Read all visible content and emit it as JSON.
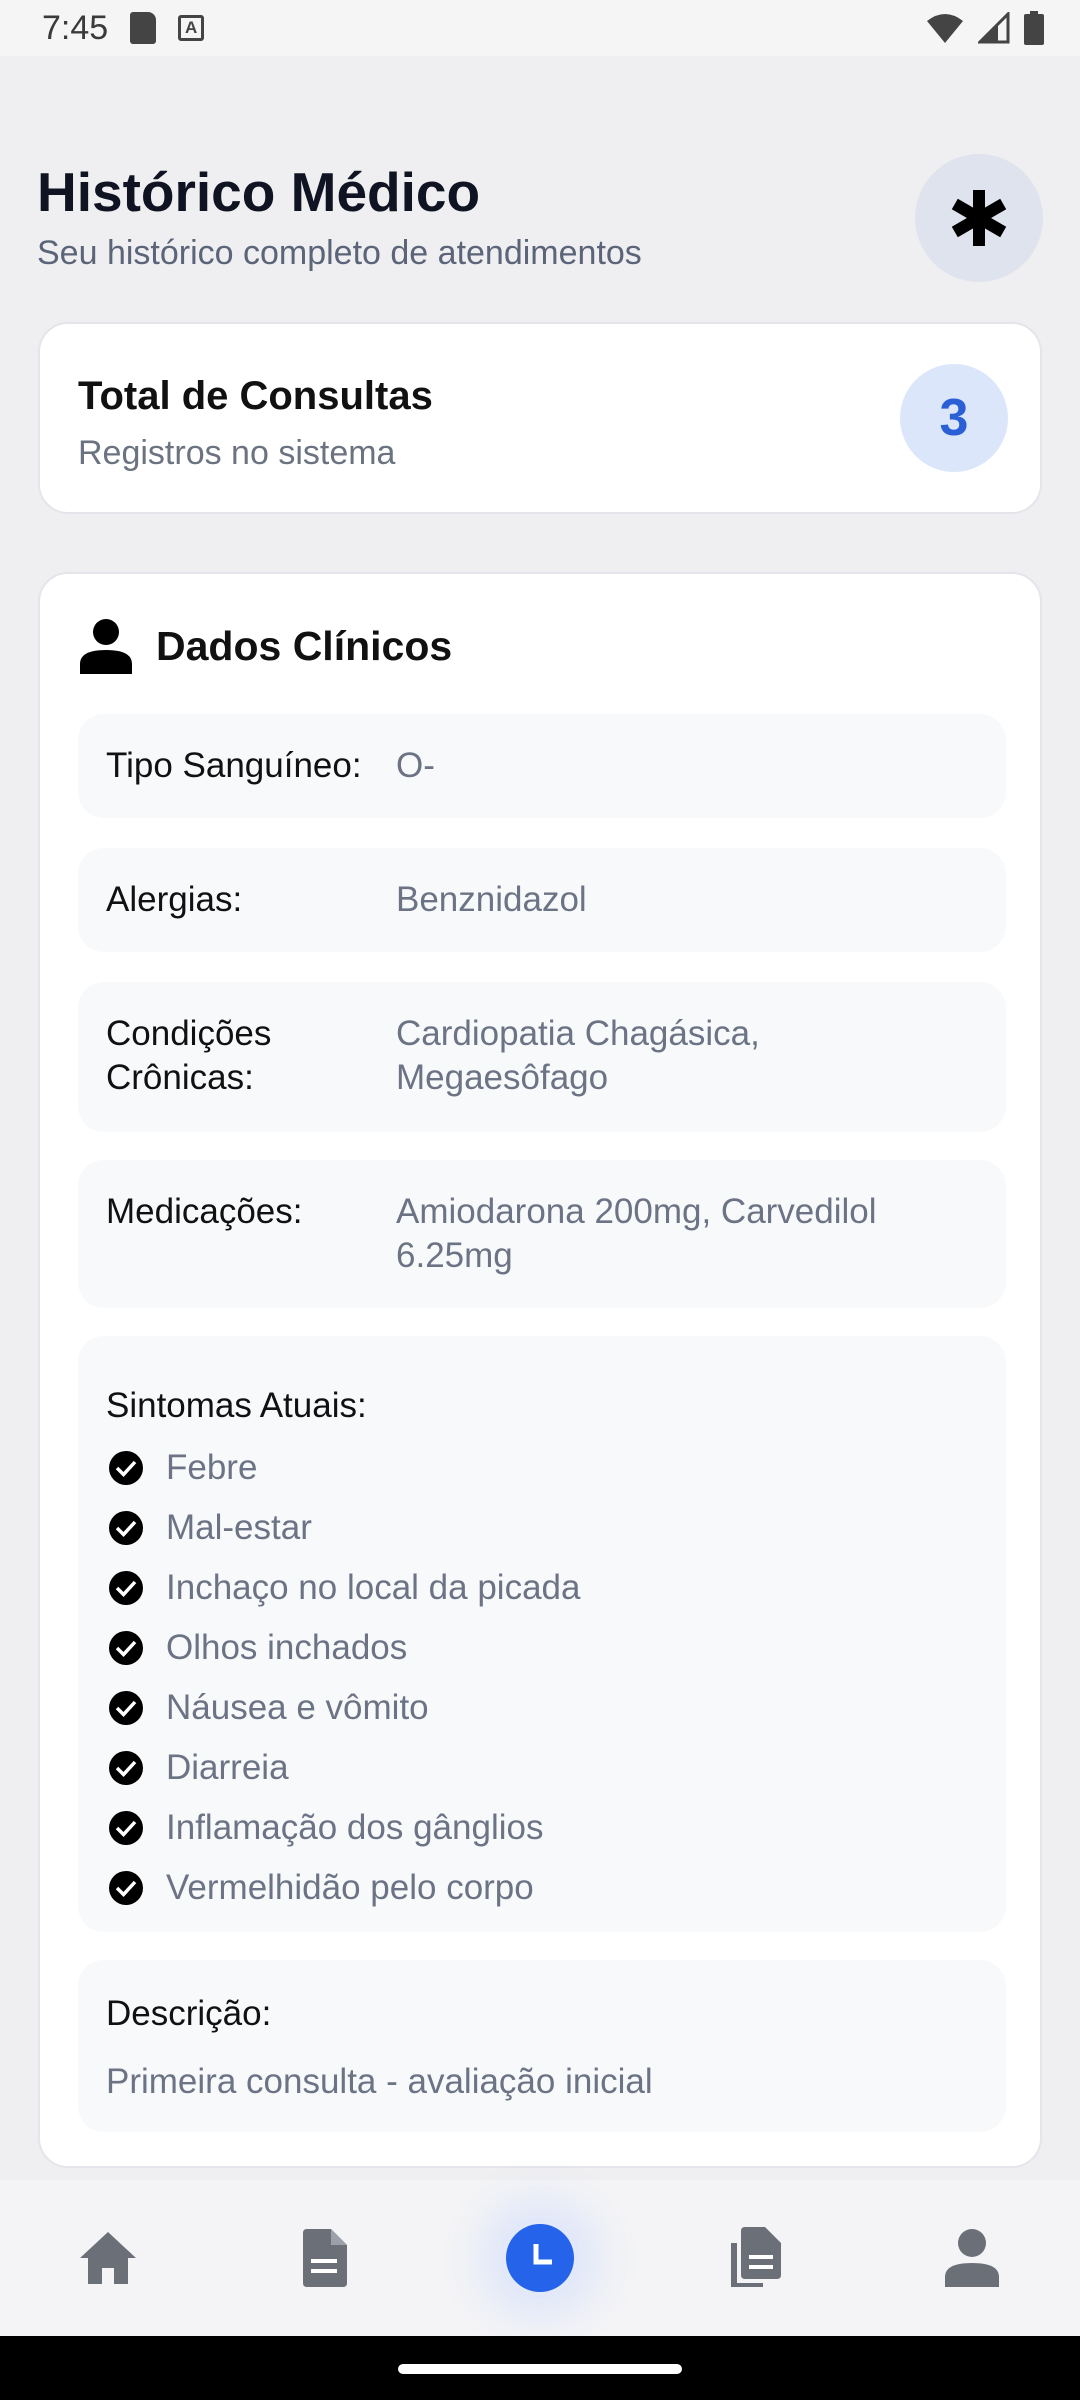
{
  "status_bar": {
    "time": "7:45"
  },
  "header": {
    "title": "Histórico Médico",
    "subtitle": "Seu histórico completo de atendimentos"
  },
  "summary": {
    "title": "Total de Consultas",
    "subtitle": "Registros no sistema",
    "count": "3"
  },
  "clinical": {
    "title": "Dados Clínicos",
    "blood_type": {
      "label": "Tipo Sanguíneo:",
      "value": "O-"
    },
    "allergies": {
      "label": "Alergias:",
      "value": "Benznidazol"
    },
    "conditions": {
      "label": "Condições Crônicas:",
      "value": "Cardiopatia Chagásica, Megaesôfago"
    },
    "medications": {
      "label": "Medicações:",
      "value": "Amiodarona 200mg, Carvedilol 6.25mg"
    },
    "symptoms": {
      "label": "Sintomas Atuais:",
      "items": [
        "Febre",
        "Mal-estar",
        "Inchaço no local da picada",
        "Olhos inchados",
        "Náusea e vômito",
        "Diarreia",
        "Inflamação dos gânglios",
        "Vermelhidão pelo corpo"
      ]
    },
    "description": {
      "label": "Descrição:",
      "value": "Primeira consulta - avaliação inicial"
    }
  },
  "nav": {
    "items": [
      "home-icon",
      "document-icon",
      "history-icon",
      "files-icon",
      "profile-icon"
    ],
    "active": "history-icon"
  },
  "colors": {
    "accent": "#2563eb",
    "background": "#efeff1"
  }
}
